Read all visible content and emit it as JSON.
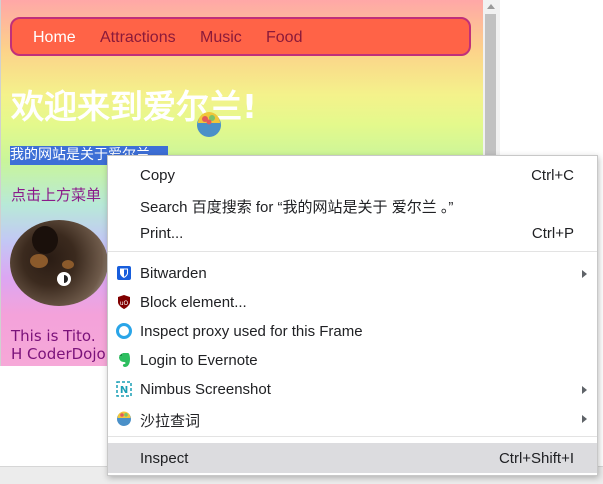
{
  "page": {
    "nav": [
      "Home",
      "Attractions",
      "Music",
      "Food"
    ],
    "heading": "欢迎来到爱尔兰!",
    "selected_text": "我的网站是关于爱尔兰。",
    "click_text": "点击上方菜单",
    "tito_text": "This is Tito. H CoderDojo."
  },
  "context_menu": {
    "copy": {
      "label": "Copy",
      "shortcut": "Ctrl+C"
    },
    "search": {
      "label": "Search 百度搜索 for “我的网站是关于 爱尔兰 。”"
    },
    "print": {
      "label": "Print...",
      "shortcut": "Ctrl+P"
    },
    "extensions": [
      {
        "label": "Bitwarden",
        "icon": "bitwarden-icon",
        "submenu": true
      },
      {
        "label": "Block element...",
        "icon": "ublock-icon",
        "submenu": false
      },
      {
        "label": "Inspect proxy used for this Frame",
        "icon": "proxy-icon",
        "submenu": false
      },
      {
        "label": "Login to Evernote",
        "icon": "evernote-icon",
        "submenu": false
      },
      {
        "label": "Nimbus Screenshot",
        "icon": "nimbus-icon",
        "submenu": true
      },
      {
        "label": "沙拉查词",
        "icon": "saladict-icon",
        "submenu": true
      }
    ],
    "inspect": {
      "label": "Inspect",
      "shortcut": "Ctrl+Shift+I"
    }
  },
  "colors": {
    "navbar": "#ff6347",
    "selection": "#3d6fd6",
    "menu_hover": "#dcdcdf"
  }
}
